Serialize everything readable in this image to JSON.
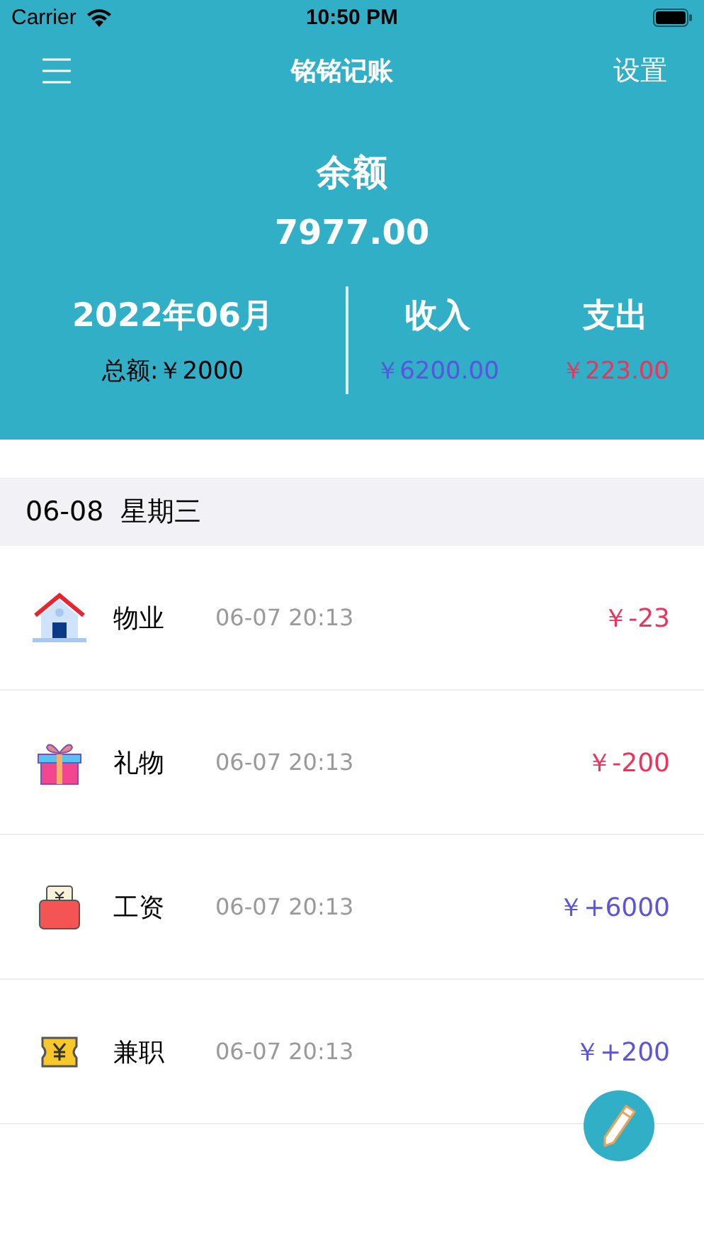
{
  "status_bar": {
    "carrier": "Carrier",
    "time": "10:50 PM"
  },
  "nav": {
    "title": "铭铭记账",
    "action": "设置"
  },
  "balance": {
    "label": "余额",
    "amount": "7977.00"
  },
  "summary": {
    "month": "2022年06月",
    "total": "总额:￥2000",
    "income_label": "收入",
    "income": "￥6200.00",
    "expense_label": "支出",
    "expense": "￥223.00"
  },
  "day": {
    "date": "06-08",
    "weekday": "星期三"
  },
  "records": [
    {
      "name": "物业",
      "time": "06-07 20:13",
      "amount": "￥-23",
      "kind": "expense"
    },
    {
      "name": "礼物",
      "time": "06-07 20:13",
      "amount": "￥-200",
      "kind": "expense"
    },
    {
      "name": "工资",
      "time": "06-07 20:13",
      "amount": "￥+6000",
      "kind": "income"
    },
    {
      "name": "兼职",
      "time": "06-07 20:13",
      "amount": "￥+200",
      "kind": "income"
    }
  ]
}
